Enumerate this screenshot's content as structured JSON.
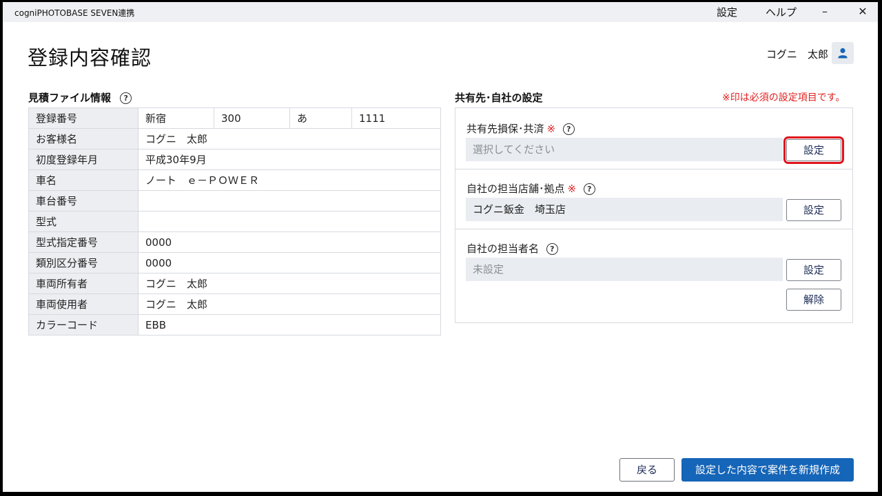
{
  "window": {
    "title": "cogniPHOTOBASE SEVEN連携",
    "menu": {
      "settings": "設定",
      "help": "ヘルプ"
    },
    "controls": {
      "minimize": "–",
      "close": "✕"
    }
  },
  "header": {
    "page_title": "登録内容確認",
    "user_name": "コグニ　太郎",
    "avatar_icon": "person-icon"
  },
  "estimate_info": {
    "section_title": "見積ファイル情報",
    "help_glyph": "?",
    "registration_number": {
      "label": "登録番号",
      "parts": [
        "新宿",
        "300",
        "あ",
        "1111"
      ]
    },
    "rows": [
      {
        "label": "お客様名",
        "value": "コグニ　太郎"
      },
      {
        "label": "初度登録年月",
        "value": "平成30年9月"
      },
      {
        "label": "車名",
        "value": "ノート　ｅ－ＰＯＷＥＲ"
      },
      {
        "label": "車台番号",
        "value": ""
      },
      {
        "label": "型式",
        "value": ""
      },
      {
        "label": "型式指定番号",
        "value": "0000"
      },
      {
        "label": "類別区分番号",
        "value": "0000"
      },
      {
        "label": "車両所有者",
        "value": "コグニ　太郎"
      },
      {
        "label": "車両使用者",
        "value": "コグニ　太郎"
      },
      {
        "label": "カラーコード",
        "value": "EBB"
      }
    ]
  },
  "share_settings": {
    "section_title": "共有先･自社の設定",
    "required_note": "※印は必須の設定項目です。",
    "required_mark": "※",
    "help_glyph": "?",
    "fields": {
      "insurer": {
        "label": "共有先損保･共済",
        "value": "選択してください",
        "button": "設定"
      },
      "branch": {
        "label": "自社の担当店舗･拠点",
        "value": "コグニ鈑金　埼玉店",
        "button": "設定"
      },
      "staff": {
        "label": "自社の担当者名",
        "value": "未設定",
        "button": "設定",
        "clear_button": "解除"
      }
    }
  },
  "footer": {
    "back_button": "戻る",
    "create_button": "設定した内容で案件を新規作成"
  },
  "colors": {
    "accent": "#1565b8",
    "required": "#e02020",
    "highlight": "#e0121b"
  }
}
